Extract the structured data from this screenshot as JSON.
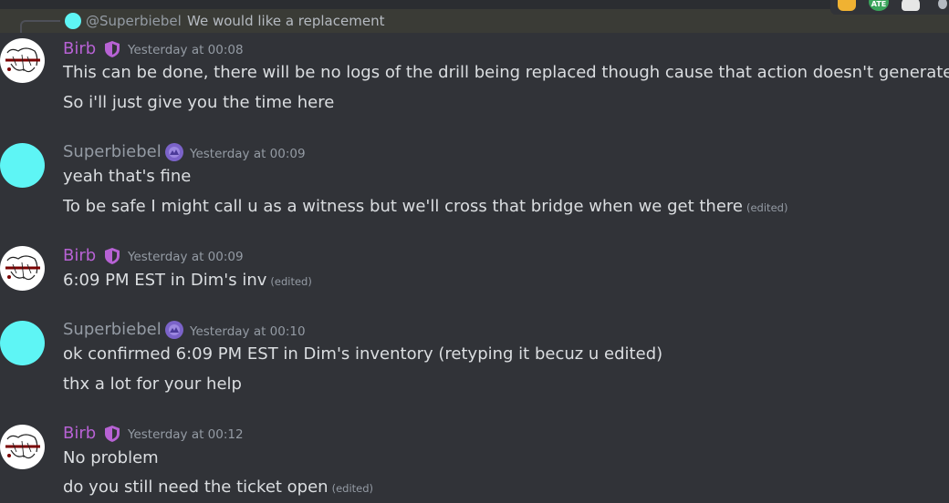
{
  "toolbar": {
    "icons": [
      "thumbs-up-icon",
      "ate-emoji-icon",
      "skull-icon",
      "more-icon"
    ],
    "ate_label": "ATE"
  },
  "reply": {
    "author": "@Superbiebel",
    "text": "We would like a replacement"
  },
  "messages": [
    {
      "author": "Birb",
      "timestamp": "Yesterday at 00:08",
      "lines": [
        {
          "text": "This can be done, there will be no logs of the drill being replaced though cause that action doesn't generate logs"
        },
        {
          "text": "So i'll just give you the time here"
        }
      ]
    },
    {
      "author": "Superbiebel",
      "timestamp": "Yesterday at 00:09",
      "lines": [
        {
          "text": "yeah that's fine"
        },
        {
          "text": "To be safe I might call u as a witness but we'll cross that bridge when we get there",
          "edited": "(edited)"
        }
      ]
    },
    {
      "author": "Birb",
      "timestamp": "Yesterday at 00:09",
      "lines": [
        {
          "text": "6:09 PM EST in Dim's inv",
          "edited": "(edited)"
        }
      ]
    },
    {
      "author": "Superbiebel",
      "timestamp": "Yesterday at 00:10",
      "lines": [
        {
          "text": "ok confirmed 6:09 PM EST in Dim's inventory (retyping it becuz u edited)"
        },
        {
          "text": "thx a lot for your help"
        }
      ]
    },
    {
      "author": "Birb",
      "timestamp": "Yesterday at 00:12",
      "lines": [
        {
          "text": "No problem"
        },
        {
          "text": "do you still need the ticket open",
          "edited": "(edited)"
        }
      ]
    }
  ],
  "colors": {
    "background": "#313338",
    "birb_name": "#b762d4",
    "superbiebel_name": "#949ba4",
    "superbiebel_avatar": "#5ef5f5",
    "message_text": "#dbdee1",
    "muted_text": "#949ba4"
  }
}
